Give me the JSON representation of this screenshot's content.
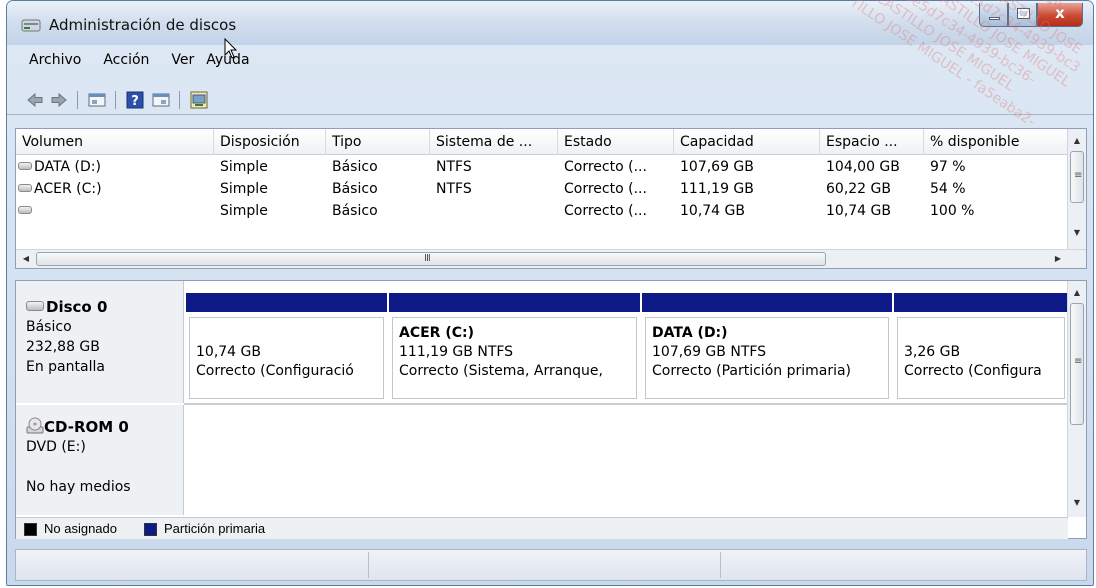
{
  "window": {
    "title": "Administración de discos",
    "close_glyph": "x"
  },
  "menu": [
    "Archivo",
    "Acción",
    "Ver",
    "Ayuda"
  ],
  "toolbar": {
    "icons": [
      "back-arrow-icon",
      "forward-arrow-icon",
      "properties-icon",
      "help-icon",
      "show-console-icon",
      "rescan-icon"
    ]
  },
  "volumes": {
    "columns": [
      "Volumen",
      "Disposición",
      "Tipo",
      "Sistema de ...",
      "Estado",
      "Capacidad",
      "Espacio ...",
      "% disponible"
    ],
    "rows": [
      {
        "volumen": "DATA (D:)",
        "disposicion": "Simple",
        "tipo": "Básico",
        "sistema": "NTFS",
        "estado": "Correcto (...",
        "capacidad": "107,69 GB",
        "espacio": "104,00 GB",
        "disponible": "97 %"
      },
      {
        "volumen": "ACER (C:)",
        "disposicion": "Simple",
        "tipo": "Básico",
        "sistema": "NTFS",
        "estado": "Correcto (...",
        "capacidad": "111,19 GB",
        "espacio": "60,22 GB",
        "disponible": "54 %"
      },
      {
        "volumen": "",
        "disposicion": "Simple",
        "tipo": "Básico",
        "sistema": "",
        "estado": "Correcto (...",
        "capacidad": "10,74 GB",
        "espacio": "10,74 GB",
        "disponible": "100 %"
      }
    ],
    "hscroll_grip": "III"
  },
  "disks": {
    "disk0": {
      "name": "Disco 0",
      "type": "Básico",
      "size": "232,88 GB",
      "status": "En pantalla",
      "partitions": [
        {
          "name": "",
          "size": "10,74 GB",
          "status": "Correcto (Configuració"
        },
        {
          "name": "ACER  (C:)",
          "size": "111,19 GB NTFS",
          "status": "Correcto (Sistema, Arranque,"
        },
        {
          "name": "DATA  (D:)",
          "size": "107,69 GB NTFS",
          "status": "Correcto (Partición primaria)"
        },
        {
          "name": "",
          "size": "3,26 GB",
          "status": "Correcto (Configura"
        }
      ]
    },
    "cdrom": {
      "name": "CD-ROM 0",
      "drive": "DVD (E:)",
      "status": "No hay medios"
    },
    "vscroll_grip": "≡"
  },
  "legend": [
    {
      "label": "No asignado",
      "color": "#000000"
    },
    {
      "label": "Partición primaria",
      "color": "#0d1a87"
    }
  ],
  "watermark": [
    "TILLO JOSE MIGUEL - fa5eaba2-",
    "CASTILLO JOSE MIGUEL",
    "8e5d7c34-4939-bc36-",
    "CASTILLO JOSE MIGUEL",
    "8e5d7c34-4939-bc3",
    "CASTILLO JOSE",
    "493"
  ]
}
